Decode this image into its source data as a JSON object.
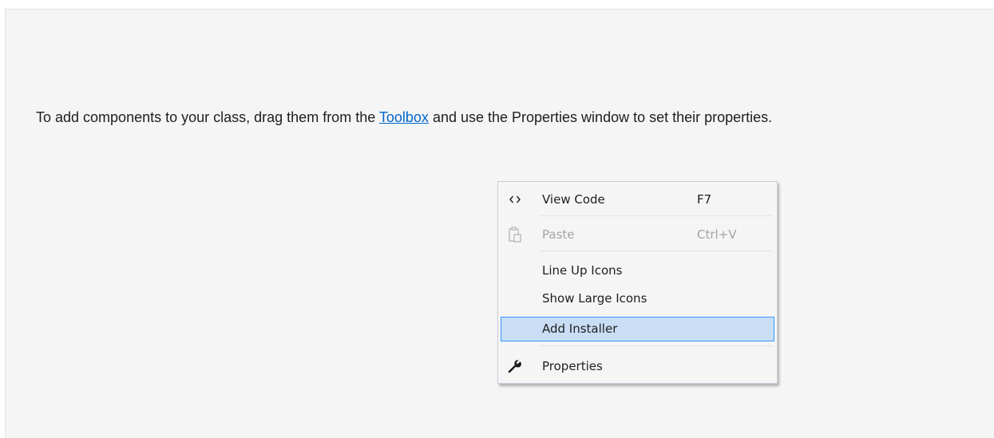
{
  "designer": {
    "hint_before": "To add components to your class, drag them from the ",
    "hint_link": "Toolbox",
    "hint_after": " and use the Properties window to set their properties."
  },
  "context_menu": {
    "items": [
      {
        "label": "View Code",
        "shortcut": "F7",
        "icon": "code-brackets-icon",
        "enabled": true
      },
      {
        "label": "Paste",
        "shortcut": "Ctrl+V",
        "icon": "paste-icon",
        "enabled": false
      },
      {
        "label": "Line Up Icons",
        "shortcut": "",
        "icon": "",
        "enabled": true
      },
      {
        "label": "Show Large Icons",
        "shortcut": "",
        "icon": "",
        "enabled": true
      },
      {
        "label": "Add Installer",
        "shortcut": "",
        "icon": "",
        "enabled": true,
        "highlighted": true
      },
      {
        "label": "Properties",
        "shortcut": "",
        "icon": "wrench-icon",
        "enabled": true
      }
    ]
  },
  "colors": {
    "surface": "#f5f5f5",
    "link": "#0066cc",
    "highlight_bg": "#c9def5",
    "highlight_border": "#3399ff",
    "disabled_text": "#a2a4a5"
  }
}
